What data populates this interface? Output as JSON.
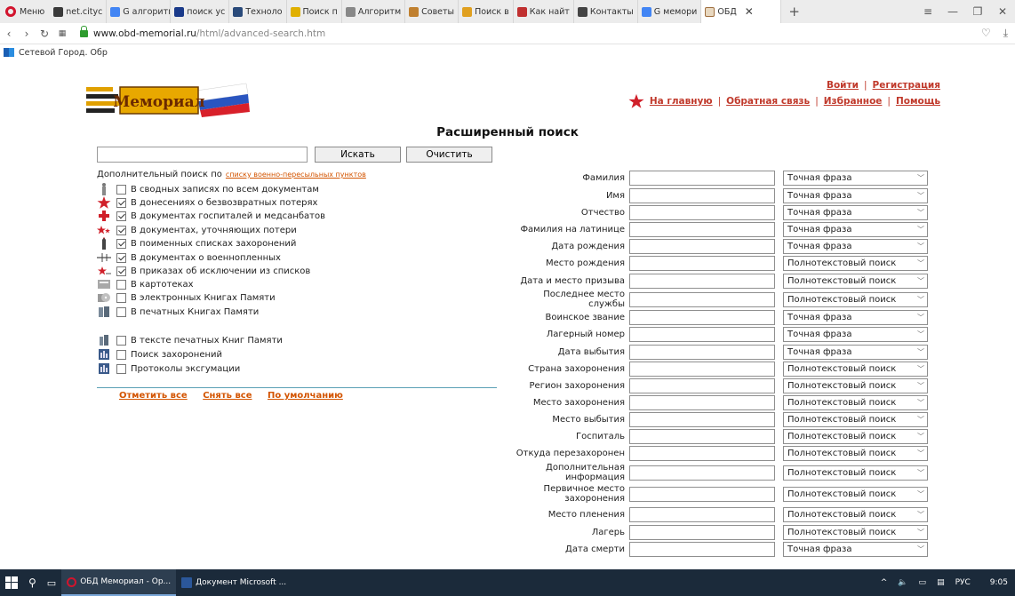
{
  "browser": {
    "menu_label": "Меню",
    "tabs": [
      {
        "label": "net.cityc",
        "color": "#3a3a3a"
      },
      {
        "label": "G алгоритм",
        "color": "#4285f4"
      },
      {
        "label": "поиск ус",
        "color": "#1a3a8a"
      },
      {
        "label": "Техноло",
        "color": "#2a4a7a"
      },
      {
        "label": "Поиск п",
        "color": "#e0b000"
      },
      {
        "label": "Алгоритм",
        "color": "#888888"
      },
      {
        "label": "Советы",
        "color": "#c08030"
      },
      {
        "label": "Поиск в",
        "color": "#e0a020"
      },
      {
        "label": "Как найт",
        "color": "#c03030"
      },
      {
        "label": "Контакты",
        "color": "#444444"
      },
      {
        "label": "G мемори",
        "color": "#4285f4"
      }
    ],
    "active_tab": "ОБД",
    "url_domain": "www.obd-memorial.ru",
    "url_path": "/html/advanced-search.htm",
    "bookmark": "Сетевой Город. Обр"
  },
  "header": {
    "logo_text": "Мемориал",
    "login": "Войти",
    "register": "Регистрация",
    "home": "На главную",
    "feedback": "Обратная связь",
    "favorites": "Избранное",
    "help": "Помощь"
  },
  "title": "Расширенный поиск",
  "search": {
    "value": "",
    "search_button": "Искать",
    "clear_button": "Очистить"
  },
  "additional": {
    "label": "Дополнительный поиск по",
    "link": "списку военно-пересыльных пунктов"
  },
  "checks": [
    {
      "label": "В сводных записях по всем документам",
      "checked": false,
      "icon": "soldier-icon"
    },
    {
      "label": "В донесениях о безвозвратных потерях",
      "checked": true,
      "icon": "red-star-icon"
    },
    {
      "label": "В документах госпиталей и медсанбатов",
      "checked": true,
      "icon": "red-cross-icon"
    },
    {
      "label": "В документах, уточняющих потери",
      "checked": true,
      "icon": "stars-icon"
    },
    {
      "label": "В поименных списках захоронений",
      "checked": true,
      "icon": "obelisk-icon"
    },
    {
      "label": "В документах о военнопленных",
      "checked": true,
      "icon": "barbed-wire-icon"
    },
    {
      "label": "В приказах об исключении из списков",
      "checked": true,
      "icon": "star-arrow-icon"
    },
    {
      "label": "В картотеках",
      "checked": false,
      "icon": "card-file-icon"
    },
    {
      "label": "В электронных Книгах Памяти",
      "checked": false,
      "icon": "disc-book-icon"
    },
    {
      "label": "В печатных Книгах Памяти",
      "checked": false,
      "icon": "printed-book-icon"
    },
    {
      "label": "В тексте печатных Книг Памяти",
      "checked": false,
      "icon": "book-text-icon"
    },
    {
      "label": "Поиск захоронений",
      "checked": false,
      "icon": "burial-search-icon"
    },
    {
      "label": "Протоколы эксгумации",
      "checked": false,
      "icon": "protocol-icon"
    }
  ],
  "select_links": {
    "check_all": "Отметить все",
    "uncheck_all": "Снять все",
    "default": "По умолчанию"
  },
  "fields": [
    {
      "label": "Фамилия",
      "mode": "Точная фраза"
    },
    {
      "label": "Имя",
      "mode": "Точная фраза"
    },
    {
      "label": "Отчество",
      "mode": "Точная фраза"
    },
    {
      "label": "Фамилия на латинице",
      "mode": "Точная фраза"
    },
    {
      "label": "Дата рождения",
      "mode": "Точная фраза"
    },
    {
      "label": "Место рождения",
      "mode": "Полнотекстовый поиск"
    },
    {
      "label": "Дата и место призыва",
      "mode": "Полнотекстовый поиск"
    },
    {
      "label": "Последнее место службы",
      "mode": "Полнотекстовый поиск"
    },
    {
      "label": "Воинское звание",
      "mode": "Точная фраза"
    },
    {
      "label": "Лагерный номер",
      "mode": "Точная фраза"
    },
    {
      "label": "Дата выбытия",
      "mode": "Точная фраза"
    },
    {
      "label": "Страна захоронения",
      "mode": "Полнотекстовый поиск"
    },
    {
      "label": "Регион захоронения",
      "mode": "Полнотекстовый поиск"
    },
    {
      "label": "Место захоронения",
      "mode": "Полнотекстовый поиск"
    },
    {
      "label": "Место выбытия",
      "mode": "Полнотекстовый поиск"
    },
    {
      "label": "Госпиталь",
      "mode": "Полнотекстовый поиск"
    },
    {
      "label": "Откуда перезахоронен",
      "mode": "Полнотекстовый поиск"
    },
    {
      "label": "Дополнительная информация",
      "mode": "Полнотекстовый поиск"
    },
    {
      "label": "Первичное место захоронения",
      "mode": "Полнотекстовый поиск"
    },
    {
      "label": "Место пленения",
      "mode": "Полнотекстовый поиск"
    },
    {
      "label": "Лагерь",
      "mode": "Полнотекстовый поиск"
    },
    {
      "label": "Дата смерти",
      "mode": "Точная фраза"
    }
  ],
  "taskbar": {
    "app1": "ОБД Мемориал - Op...",
    "app2": "Документ Microsoft ...",
    "lang": "РУС",
    "time": "9:05"
  }
}
